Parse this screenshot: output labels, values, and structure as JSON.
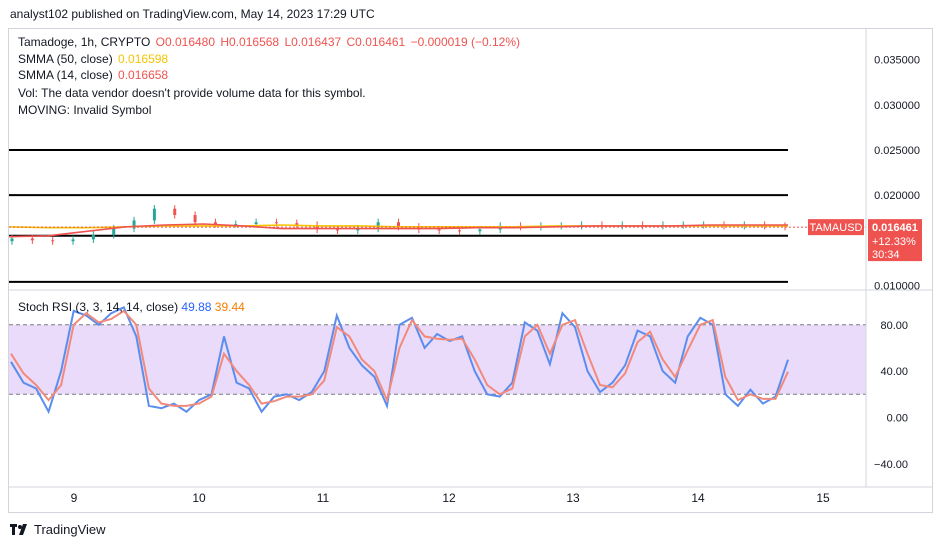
{
  "header": {
    "publisher_line": "analyst102 published on TradingView.com, May 14, 2023 17:29 UTC"
  },
  "legend": {
    "symbol": "Tamadoge, 1h, CRYPTO",
    "open": "O0.016480",
    "high": "H0.016568",
    "low": "L0.016437",
    "close": "C0.016461",
    "change": "−0.000019 (−0.12%)",
    "sma50_label": "SMMA (50, close)",
    "sma50_value": "0.016598",
    "sma14_label": "SMMA (14, close)",
    "sma14_value": "0.016658",
    "vol_note": "Vol: The data vendor doesn't provide volume data for this symbol.",
    "moving_note": "MOVING: Invalid Symbol"
  },
  "price_badge": {
    "ticker": "TAMAUSD",
    "price": "0.016461",
    "change": "+12.33%",
    "countdown": "30:34"
  },
  "indicator": {
    "label": "Stoch RSI (3, 3, 14, 14, close)",
    "k_value": "49.88",
    "d_value": "39.44"
  },
  "footer": {
    "brand": "TradingView"
  },
  "colors": {
    "candle_up": "#26a69a",
    "candle_down": "#ef5350",
    "sma50": "#f5c400",
    "sma14": "#ef5350",
    "stoch_k": "#5b8def",
    "stoch_d": "#f28a7c",
    "stoch_band": "#e1cff7"
  },
  "chart_data": [
    {
      "type": "candlestick",
      "title": "Tamadoge, 1h, CRYPTO",
      "x_ticks": [
        "9",
        "10",
        "11",
        "12",
        "13",
        "14",
        "15"
      ],
      "y_ticks": [
        "0.035000",
        "0.030000",
        "0.025000",
        "0.020000",
        "0.015000",
        "0.010000"
      ],
      "ylim": [
        0.0095,
        0.0385
      ],
      "horizontal_levels": [
        0.025,
        0.02,
        0.0155,
        0.0104
      ],
      "last_price": 0.016461,
      "series": [
        {
          "name": "SMMA (50, close)",
          "values": [
            0.0165,
            0.0164,
            0.0164,
            0.0165,
            0.0166,
            0.0166,
            0.0166,
            0.0167,
            0.0166,
            0.0166,
            0.0165,
            0.0165,
            0.0165,
            0.0165,
            0.0166,
            0.0166,
            0.0166,
            0.0166,
            0.0166,
            0.0166,
            0.0166
          ]
        },
        {
          "name": "SMMA (14, close)",
          "values": [
            0.0154,
            0.0155,
            0.016,
            0.0165,
            0.0167,
            0.0168,
            0.0166,
            0.0163,
            0.0163,
            0.0163,
            0.0163,
            0.0163,
            0.0164,
            0.0164,
            0.0165,
            0.0166,
            0.0166,
            0.0166,
            0.0167,
            0.0167,
            0.0167
          ]
        }
      ],
      "candles_close": [
        0.0152,
        0.015,
        0.0149,
        0.0151,
        0.0156,
        0.0163,
        0.0172,
        0.0185,
        0.0178,
        0.017,
        0.0168,
        0.0168,
        0.017,
        0.0169,
        0.0167,
        0.0162,
        0.0161,
        0.0163,
        0.017,
        0.0165,
        0.0162,
        0.0161,
        0.016,
        0.0162,
        0.0166,
        0.0165,
        0.0166,
        0.0166,
        0.0167,
        0.0166,
        0.0167,
        0.0166,
        0.0167,
        0.0167,
        0.0167,
        0.0166,
        0.0167,
        0.0166,
        0.0165
      ]
    },
    {
      "type": "line",
      "title": "Stoch RSI (3, 3, 14, 14, close)",
      "y_ticks": [
        "80.00",
        "40.00",
        "0.00",
        "−40.00"
      ],
      "ylim": [
        -60,
        110
      ],
      "bands": [
        20,
        80
      ],
      "series": [
        {
          "name": "K",
          "values": [
            48,
            30,
            25,
            5,
            40,
            92,
            88,
            80,
            90,
            95,
            70,
            10,
            8,
            12,
            5,
            15,
            20,
            70,
            30,
            25,
            5,
            18,
            20,
            15,
            22,
            40,
            88,
            60,
            45,
            35,
            10,
            80,
            86,
            60,
            72,
            66,
            70,
            40,
            20,
            18,
            30,
            82,
            75,
            46,
            90,
            78,
            40,
            22,
            30,
            45,
            75,
            70,
            40,
            30,
            70,
            86,
            80,
            20,
            10,
            24,
            12,
            18,
            49.88
          ]
        },
        {
          "name": "D",
          "values": [
            55,
            38,
            28,
            15,
            28,
            80,
            90,
            82,
            85,
            92,
            80,
            25,
            12,
            10,
            10,
            12,
            18,
            55,
            40,
            28,
            12,
            14,
            18,
            18,
            20,
            32,
            78,
            70,
            50,
            40,
            15,
            60,
            84,
            70,
            68,
            67,
            68,
            50,
            28,
            20,
            25,
            70,
            80,
            55,
            80,
            84,
            55,
            28,
            26,
            38,
            65,
            74,
            50,
            35,
            58,
            80,
            84,
            35,
            15,
            20,
            16,
            16,
            39.44
          ]
        }
      ]
    }
  ]
}
